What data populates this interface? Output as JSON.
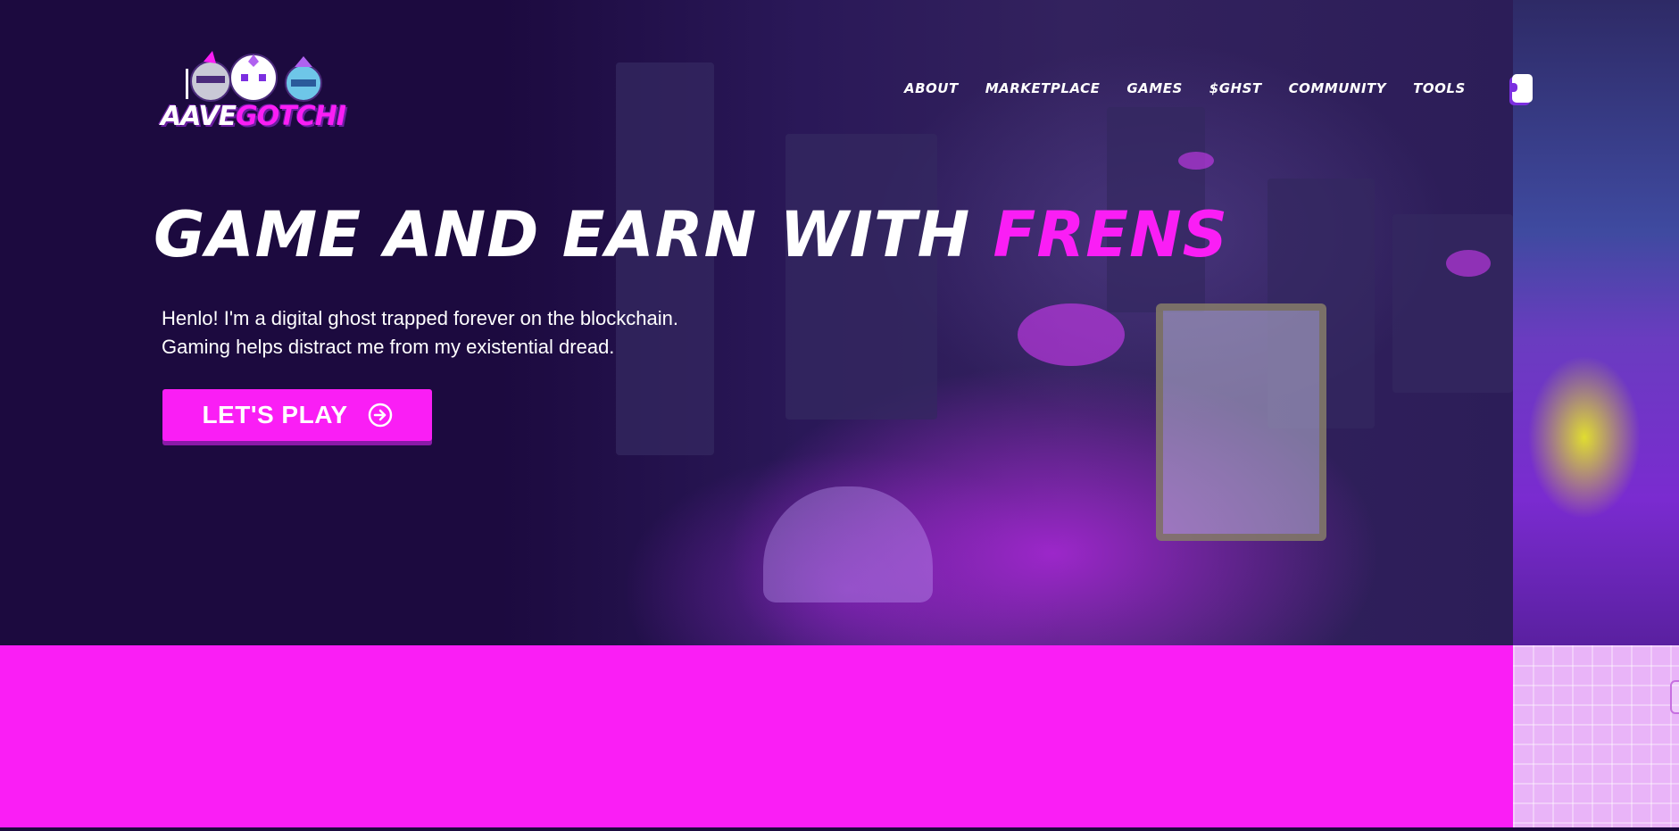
{
  "brand": {
    "logo_text_main": "AAVE",
    "logo_text_accent": "GOTCHI",
    "accent_color": "#fa1ef5",
    "background_color": "#1c0a3f"
  },
  "nav": {
    "items": [
      {
        "label": "About"
      },
      {
        "label": "Marketplace"
      },
      {
        "label": "Games"
      },
      {
        "label": "$GHST"
      },
      {
        "label": "Community"
      },
      {
        "label": "Tools"
      }
    ],
    "extra_button_icon": "partial-button-icon"
  },
  "hero": {
    "headline_main": "GAME AND EARN WITH ",
    "headline_accent": "FRENS",
    "subtitle_line1": "Henlo! I'm a digital ghost trapped forever on the blockchain.",
    "subtitle_line2": "Gaming helps distract me from my existential dread.",
    "cta_label": "LET'S PLAY",
    "cta_icon": "arrow-circle-right-icon"
  }
}
